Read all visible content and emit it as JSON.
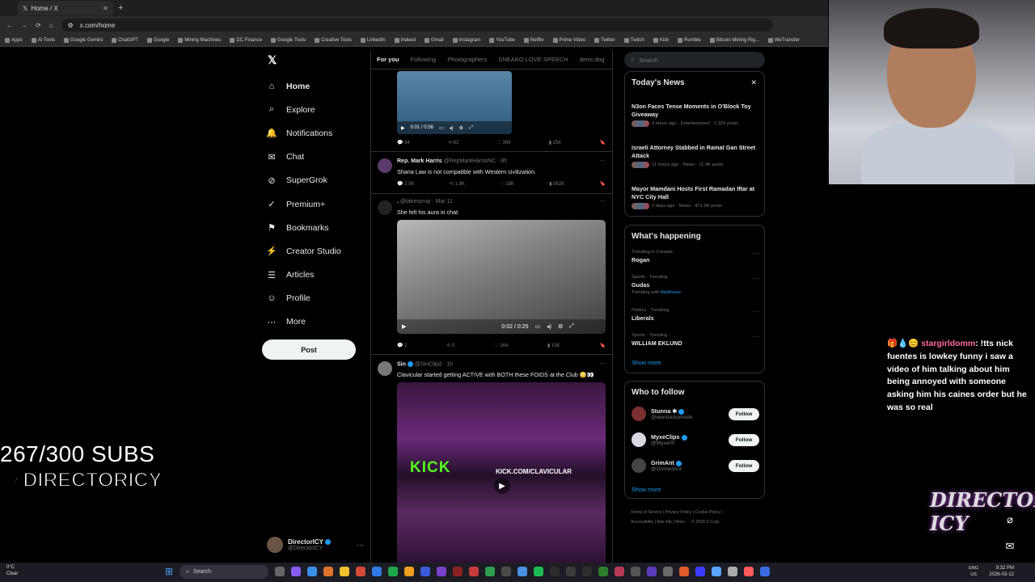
{
  "browser": {
    "tab_title": "Home / X",
    "url": "x.com/home",
    "bookmarks": [
      "Apps",
      "AI Tools",
      "Google Gemini",
      "ChatGPT",
      "Google",
      "Mining Machines",
      "DC Finance",
      "Google Tools",
      "Creative Tools",
      "LinkedIn",
      "Indeed",
      "Gmail",
      "Instagram",
      "YouTube",
      "Netflix",
      "Prime Video",
      "Twitter",
      "Twitch",
      "Kick",
      "Rumble",
      "Bitcoin Mining Rig...",
      "WeTransfer"
    ]
  },
  "nav": {
    "items": [
      {
        "label": "Home",
        "icon": "home-icon"
      },
      {
        "label": "Explore",
        "icon": "search-icon"
      },
      {
        "label": "Notifications",
        "icon": "bell-icon"
      },
      {
        "label": "Chat",
        "icon": "mail-icon"
      },
      {
        "label": "SuperGrok",
        "icon": "grok-icon"
      },
      {
        "label": "Premium+",
        "icon": "premium-icon"
      },
      {
        "label": "Bookmarks",
        "icon": "bookmark-icon"
      },
      {
        "label": "Creator Studio",
        "icon": "creator-studio-icon"
      },
      {
        "label": "Articles",
        "icon": "articles-icon"
      },
      {
        "label": "Profile",
        "icon": "profile-icon"
      },
      {
        "label": "More",
        "icon": "more-icon"
      }
    ],
    "post_label": "Post",
    "user": {
      "name": "DirectorICY",
      "handle": "@DirectorICY"
    }
  },
  "feed": {
    "tabs": [
      "For you",
      "Following",
      "Photographers",
      "SNEAKO LOVE SPEECH",
      "demi dog"
    ],
    "video1": {
      "time": "0:01 / 0:56"
    },
    "stats1": {
      "replies": "94",
      "reposts": "82",
      "likes": "399",
      "views": "25K"
    },
    "post2": {
      "name": "Rep. Mark Harris",
      "handle": "@RepMarkHarrisNC · 8h",
      "text": "Sharia Law is not compatible with Western civilization.",
      "replies": "2.5K",
      "reposts": "1.9K",
      "likes": "18K",
      "views": "562K"
    },
    "post3": {
      "name": ".",
      "handle": "@takesyrup · Mar 11",
      "text": "She felt his aura in chat",
      "time": "0:02 / 0:25",
      "replies": "2",
      "reposts": "5",
      "likes": "164",
      "views": "15K"
    },
    "post4": {
      "name": "Sin",
      "handle": "@SinClipd · 1h",
      "text": "Clavicular started getting ACTIVE with BOTH these FOIDS at the Club 😳👀",
      "overlay_brand": "KICK",
      "overlay_url": "KICK.COM/CLAVICULAR"
    }
  },
  "sidebar": {
    "search_placeholder": "Search",
    "news_title": "Today's News",
    "news": [
      {
        "title": "N3on Faces Tense Moments in O'Block Toy Giveaway",
        "meta": "4 hours ago · Entertainment · 1,329 posts"
      },
      {
        "title": "Israeli Attorney Stabbed in Ramat Gan Street Attack",
        "meta": "11 hours ago · News · 11.4K posts"
      },
      {
        "title": "Mayor Mamdani Hosts First Ramadan Iftar at NYC City Hall",
        "meta": "2 days ago · News · 471.5K posts"
      }
    ],
    "happening_title": "What's happening",
    "trends": [
      {
        "context": "Trending in Canada",
        "name": "Rogan",
        "sub": "",
        "sub_link": ""
      },
      {
        "context": "Sports · Trending",
        "name": "Gudas",
        "sub": "Trending with",
        "sub_link": "Matthews"
      },
      {
        "context": "Politics · Trending",
        "name": "Liberals",
        "sub": "",
        "sub_link": ""
      },
      {
        "context": "Sports · Trending",
        "name": "WILLIAM EKLUND",
        "sub": "",
        "sub_link": ""
      }
    ],
    "show_more": "Show more",
    "wtf_title": "Who to follow",
    "wtf": [
      {
        "name": "Stunna ✱",
        "handle": "@wentsickomode",
        "button": "Follow"
      },
      {
        "name": "MyxeClips",
        "handle": "@Myxe00",
        "button": "Follow"
      },
      {
        "name": "GrimAnt",
        "handle": "@GrimedAnt",
        "button": "Follow"
      }
    ],
    "footer_line1": "Terms of Service  |  Privacy Policy  |  Cookie Policy  |",
    "footer_line2": "Accessibility  |  Ads info  |  More ···  © 2026 X Corp."
  },
  "overlay": {
    "subs": "267/300 SUBS",
    "handle": "@DIRECTORICY",
    "chat_user": "stargirldomm",
    "chat_msg": ": !tts nick fuentes is lowkey funny i saw a video of him talking about him being annoyed with someone asking him his caines order but he was so real",
    "brand": "DirectorICY"
  },
  "taskbar": {
    "temp": "0°C",
    "weather": "Clear",
    "search": "Search",
    "lang1": "ENG",
    "lang2": "US",
    "time": "9:32 PM",
    "date": "2026-03-12"
  },
  "colors": {
    "accent": "#1d9bf0",
    "kick": "#53fc18",
    "chat_user": "#ff6b9d"
  }
}
